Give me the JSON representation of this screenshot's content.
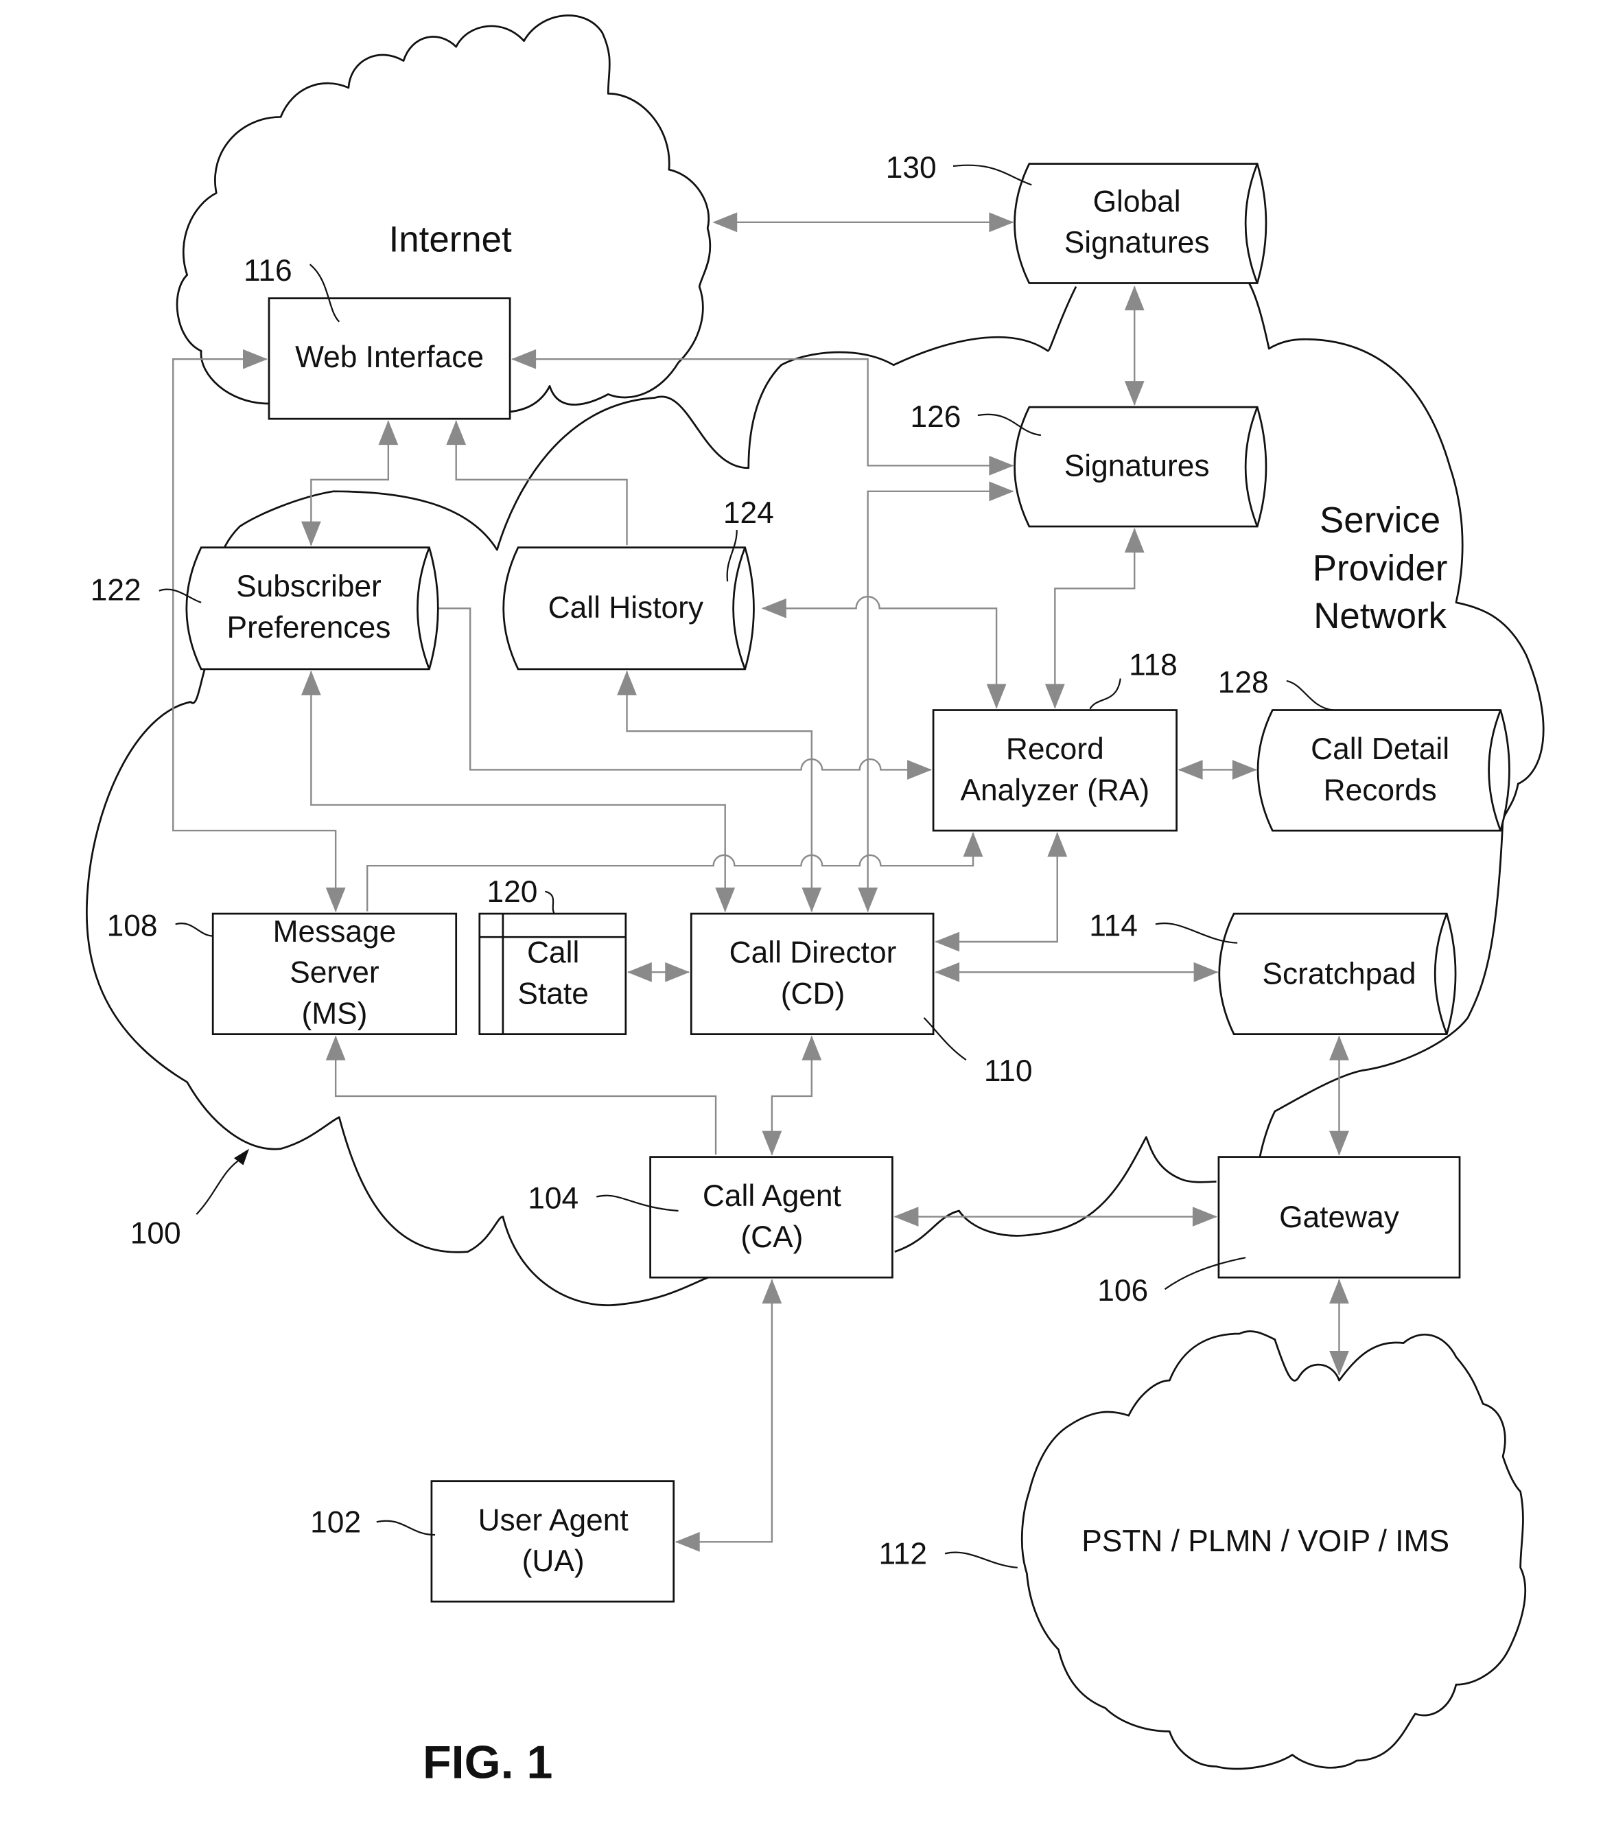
{
  "figure": {
    "title": "FIG. 1",
    "system_ref": "100"
  },
  "clouds": {
    "internet": {
      "label": "Internet"
    },
    "service_provider": {
      "label_lines": [
        "Service",
        "Provider",
        "Network"
      ]
    },
    "pstn": {
      "label": "PSTN / PLMN / VOIP / IMS",
      "ref": "112"
    }
  },
  "components": {
    "web_interface": {
      "ref": "116",
      "lines": [
        "Web Interface"
      ]
    },
    "global_signatures": {
      "ref": "130",
      "lines": [
        "Global",
        "Signatures"
      ]
    },
    "signatures": {
      "ref": "126",
      "lines": [
        "Signatures"
      ]
    },
    "subscriber_preferences": {
      "ref": "122",
      "lines": [
        "Subscriber",
        "Preferences"
      ]
    },
    "call_history": {
      "ref": "124",
      "lines": [
        "Call History"
      ]
    },
    "record_analyzer": {
      "ref": "118",
      "lines": [
        "Record",
        "Analyzer (RA)"
      ]
    },
    "call_detail_records": {
      "ref": "128",
      "lines": [
        "Call Detail",
        "Records"
      ]
    },
    "message_server": {
      "ref": "108",
      "lines": [
        "Message",
        "Server",
        "(MS)"
      ]
    },
    "call_state": {
      "ref": "120",
      "lines": [
        "Call",
        "State"
      ]
    },
    "call_director": {
      "ref": "110",
      "lines": [
        "Call Director",
        "(CD)"
      ]
    },
    "scratchpad": {
      "ref": "114",
      "lines": [
        "Scratchpad"
      ]
    },
    "call_agent": {
      "ref": "104",
      "lines": [
        "Call Agent",
        "(CA)"
      ]
    },
    "gateway": {
      "ref": "106",
      "lines": [
        "Gateway"
      ]
    },
    "user_agent": {
      "ref": "102",
      "lines": [
        "User Agent",
        "(UA)"
      ]
    }
  }
}
